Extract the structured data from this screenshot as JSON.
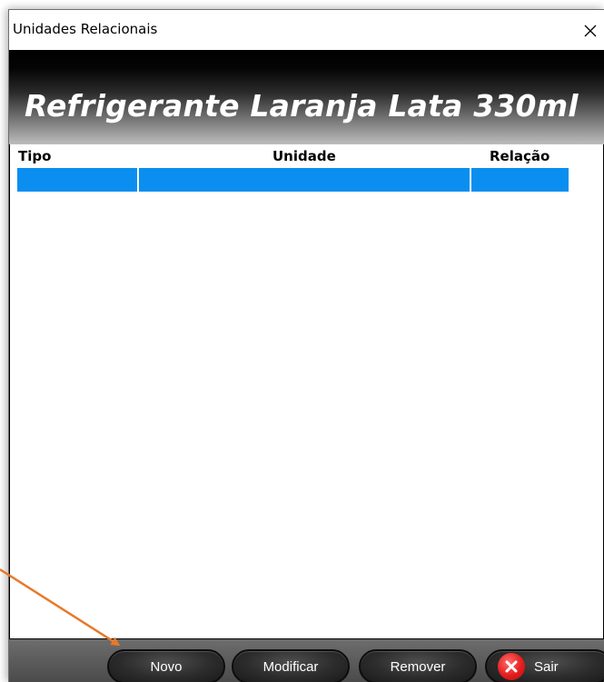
{
  "window": {
    "title": "Unidades Relacionais",
    "close_glyph": "✕"
  },
  "header": {
    "product_name": "Refrigerante Laranja Lata 330ml"
  },
  "grid": {
    "columns": [
      "Tipo",
      "Unidade",
      "Relação"
    ],
    "rows": [
      [
        "",
        "",
        ""
      ]
    ],
    "selected_row_color": "#0a8ff0"
  },
  "footer": {
    "buttons": {
      "novo": "Novo",
      "modificar": "Modificar",
      "remover": "Remover",
      "sair": "Sair"
    }
  },
  "annotation": {
    "color": "#e8792a",
    "icon": "arrow-pointer"
  }
}
